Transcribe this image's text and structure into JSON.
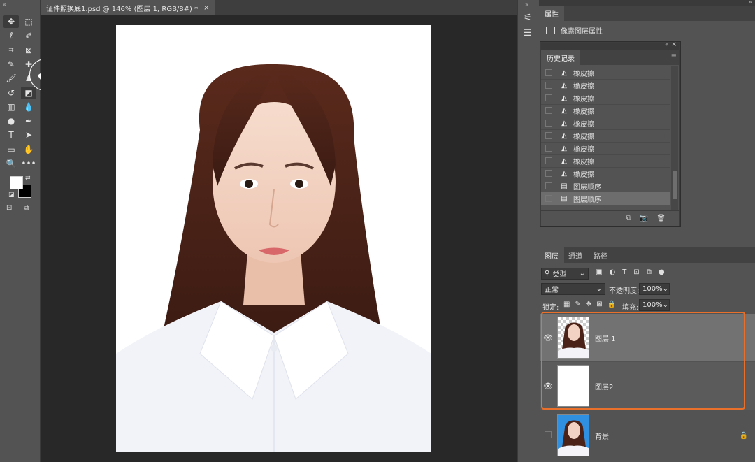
{
  "document": {
    "tab_title": "证件照换底1.psd @ 146% (图层 1, RGB/8#) *",
    "close_glyph": "×"
  },
  "toolbar": {
    "grip": "«",
    "tools": [
      {
        "name": "move-tool",
        "glyph": "✥"
      },
      {
        "name": "marquee-tool",
        "glyph": "⬚"
      },
      {
        "name": "lasso-tool",
        "glyph": "ℓ"
      },
      {
        "name": "quick-select-tool",
        "glyph": "✐"
      },
      {
        "name": "crop-tool",
        "glyph": "⌗"
      },
      {
        "name": "frame-tool",
        "glyph": "⊠"
      },
      {
        "name": "eyedropper-tool",
        "glyph": "✎"
      },
      {
        "name": "healing-tool",
        "glyph": "✚"
      },
      {
        "name": "brush-tool",
        "glyph": "🖌"
      },
      {
        "name": "stamp-tool",
        "glyph": "♟"
      },
      {
        "name": "history-brush-tool",
        "glyph": "↺"
      },
      {
        "name": "eraser-tool",
        "glyph": "◩"
      },
      {
        "name": "gradient-tool",
        "glyph": "▥"
      },
      {
        "name": "blur-tool",
        "glyph": "💧"
      },
      {
        "name": "dodge-tool",
        "glyph": "●"
      },
      {
        "name": "pen-tool",
        "glyph": "✒"
      },
      {
        "name": "type-tool",
        "glyph": "T"
      },
      {
        "name": "path-select-tool",
        "glyph": "➤"
      },
      {
        "name": "rectangle-tool",
        "glyph": "▭"
      },
      {
        "name": "hand-tool",
        "glyph": "✋"
      },
      {
        "name": "zoom-tool",
        "glyph": "🔍"
      },
      {
        "name": "more-tools",
        "glyph": "•••"
      }
    ],
    "foreground_color": "#ffffff",
    "background_color": "#000000"
  },
  "properties": {
    "tab": "属性",
    "label": "像素图层属性"
  },
  "history": {
    "tab": "历史记录",
    "items": [
      {
        "label": "橡皮擦",
        "icon": "eraser-icon"
      },
      {
        "label": "橡皮擦",
        "icon": "eraser-icon"
      },
      {
        "label": "橡皮擦",
        "icon": "eraser-icon"
      },
      {
        "label": "橡皮擦",
        "icon": "eraser-icon"
      },
      {
        "label": "橡皮擦",
        "icon": "eraser-icon"
      },
      {
        "label": "橡皮擦",
        "icon": "eraser-icon"
      },
      {
        "label": "橡皮擦",
        "icon": "eraser-icon"
      },
      {
        "label": "橡皮擦",
        "icon": "eraser-icon"
      },
      {
        "label": "橡皮擦",
        "icon": "eraser-icon"
      },
      {
        "label": "图层顺序",
        "icon": "document-icon"
      },
      {
        "label": "图层顺序",
        "icon": "document-icon",
        "selected": true
      }
    ]
  },
  "layers": {
    "tabs": [
      "图层",
      "通道",
      "路径"
    ],
    "filter_label": "类型",
    "blend_mode": "正常",
    "opacity_label": "不透明度:",
    "opacity_value": "100%",
    "lock_label": "锁定:",
    "fill_label": "填充:",
    "fill_value": "100%",
    "items": [
      {
        "name": "图层 1",
        "visible": true,
        "thumb": "portrait-transparent"
      },
      {
        "name": "图层2",
        "visible": true,
        "thumb": "white"
      },
      {
        "name": "背景",
        "visible": false,
        "thumb": "portrait-blue",
        "locked": true
      }
    ],
    "highlight_color": "#e8702a"
  }
}
